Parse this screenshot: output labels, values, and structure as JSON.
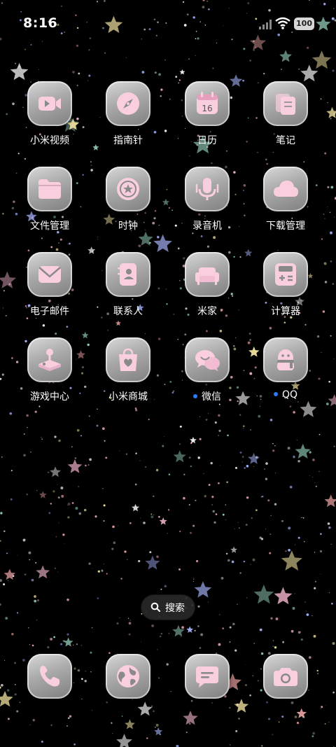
{
  "status_bar": {
    "time": "8:16",
    "battery": "100"
  },
  "apps": [
    {
      "label": "小米视频",
      "icon": "video-icon",
      "dot": false
    },
    {
      "label": "指南针",
      "icon": "compass-icon",
      "dot": false
    },
    {
      "label": "日历",
      "icon": "calendar-icon",
      "calendar_day": "16",
      "dot": false
    },
    {
      "label": "笔记",
      "icon": "notes-icon",
      "dot": false
    },
    {
      "label": "文件管理",
      "icon": "folder-icon",
      "dot": false
    },
    {
      "label": "时钟",
      "icon": "clock-icon",
      "dot": false
    },
    {
      "label": "录音机",
      "icon": "microphone-icon",
      "dot": false
    },
    {
      "label": "下载管理",
      "icon": "cloud-icon",
      "dot": false
    },
    {
      "label": "电子邮件",
      "icon": "mail-icon",
      "dot": false
    },
    {
      "label": "联系人",
      "icon": "contacts-icon",
      "dot": false
    },
    {
      "label": "米家",
      "icon": "sofa-icon",
      "dot": false
    },
    {
      "label": "计算器",
      "icon": "calculator-icon",
      "dot": false
    },
    {
      "label": "游戏中心",
      "icon": "joystick-icon",
      "dot": false
    },
    {
      "label": "小米商城",
      "icon": "shopping-bag-icon",
      "dot": false
    },
    {
      "label": "微信",
      "icon": "chat-bubbles-icon",
      "dot": true
    },
    {
      "label": "QQ",
      "icon": "penguin-icon",
      "dot": true
    }
  ],
  "search": {
    "label": "搜索"
  },
  "dock": [
    {
      "icon": "phone-icon"
    },
    {
      "icon": "browser-globe-icon"
    },
    {
      "icon": "messages-icon"
    },
    {
      "icon": "camera-icon"
    }
  ],
  "colors": {
    "icon_pink": "#f9cfe0",
    "tile_light": "#d9d9d9",
    "tile_dark": "#7f7f7f",
    "notification_dot": "#2b7cff"
  }
}
